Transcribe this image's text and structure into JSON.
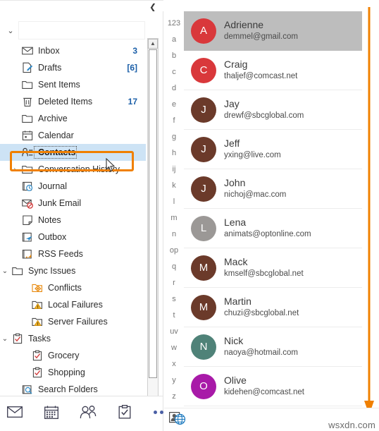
{
  "window": {
    "collapse_icon": "chevron-left-icon"
  },
  "sidebar": {
    "account_header": {
      "expander": "chevron-down-icon",
      "label": ""
    },
    "scrollbar": {
      "up_arrow": "▲",
      "down_arrow": "▼"
    },
    "items": [
      {
        "label": "Inbox",
        "count": "3",
        "icon": "envelope-icon",
        "indent": 1,
        "expander": "",
        "selected": false
      },
      {
        "label": "Drafts",
        "count": "[6]",
        "icon": "draft-pencil-icon",
        "indent": 1,
        "expander": "",
        "selected": false
      },
      {
        "label": "Sent Items",
        "count": "",
        "icon": "folder-icon",
        "indent": 1,
        "expander": "",
        "selected": false
      },
      {
        "label": "Deleted Items",
        "count": "17",
        "icon": "trash-icon",
        "indent": 1,
        "expander": "",
        "selected": false
      },
      {
        "label": "Archive",
        "count": "",
        "icon": "folder-icon",
        "indent": 1,
        "expander": "",
        "selected": false
      },
      {
        "label": "Calendar",
        "count": "",
        "icon": "calendar-icon",
        "indent": 1,
        "expander": "",
        "selected": false
      },
      {
        "label": "Contacts",
        "count": "",
        "icon": "contacts-icon",
        "indent": 1,
        "expander": "",
        "selected": true
      },
      {
        "label": "Conversation History",
        "count": "",
        "icon": "folder-icon",
        "indent": 1,
        "expander": "›",
        "selected": false
      },
      {
        "label": "Journal",
        "count": "",
        "icon": "journal-clock-icon",
        "indent": 1,
        "expander": "",
        "selected": false
      },
      {
        "label": "Junk Email",
        "count": "",
        "icon": "junk-email-icon",
        "indent": 1,
        "expander": "",
        "selected": false
      },
      {
        "label": "Notes",
        "count": "",
        "icon": "note-icon",
        "indent": 1,
        "expander": "",
        "selected": false
      },
      {
        "label": "Outbox",
        "count": "",
        "icon": "outbox-icon",
        "indent": 1,
        "expander": "",
        "selected": false
      },
      {
        "label": "RSS Feeds",
        "count": "",
        "icon": "rss-folder-icon",
        "indent": 1,
        "expander": "",
        "selected": false
      },
      {
        "label": "Sync Issues",
        "count": "",
        "icon": "folder-icon",
        "indent": 0,
        "expander": "⌄",
        "selected": false
      },
      {
        "label": "Conflicts",
        "count": "",
        "icon": "conflicts-icon",
        "indent": 2,
        "expander": "",
        "selected": false
      },
      {
        "label": "Local Failures",
        "count": "",
        "icon": "warning-folder-icon",
        "indent": 2,
        "expander": "",
        "selected": false
      },
      {
        "label": "Server Failures",
        "count": "",
        "icon": "warning-folder-icon",
        "indent": 2,
        "expander": "",
        "selected": false
      },
      {
        "label": "Tasks",
        "count": "",
        "icon": "task-clipboard-icon",
        "indent": 0,
        "expander": "⌄",
        "selected": false
      },
      {
        "label": "Grocery",
        "count": "",
        "icon": "task-clipboard-icon",
        "indent": 2,
        "expander": "",
        "selected": false
      },
      {
        "label": "Shopping",
        "count": "",
        "icon": "task-clipboard-icon",
        "indent": 2,
        "expander": "",
        "selected": false
      },
      {
        "label": "Search Folders",
        "count": "",
        "icon": "search-folder-icon",
        "indent": 1,
        "expander": "",
        "selected": false
      }
    ]
  },
  "alpha_index": [
    "123",
    "a",
    "b",
    "c",
    "d",
    "e",
    "f",
    "g",
    "h",
    "ij",
    "k",
    "l",
    "m",
    "n",
    "op",
    "q",
    "r",
    "s",
    "t",
    "uv",
    "w",
    "x",
    "y",
    "z"
  ],
  "people": [
    {
      "name": "Adrienne",
      "email": "demmel@gmail.com",
      "initial": "A",
      "color": "#d9383b",
      "selected": true
    },
    {
      "name": "Craig",
      "email": "thaljef@comcast.net",
      "initial": "C",
      "color": "#d9383b",
      "selected": false
    },
    {
      "name": "Jay",
      "email": "drewf@sbcglobal.com",
      "initial": "J",
      "color": "#6b3a2a",
      "selected": false
    },
    {
      "name": "Jeff",
      "email": "yxing@live.com",
      "initial": "J",
      "color": "#6b3a2a",
      "selected": false
    },
    {
      "name": "John",
      "email": "nichoj@mac.com",
      "initial": "J",
      "color": "#6b3a2a",
      "selected": false
    },
    {
      "name": "Lena",
      "email": "animats@optonline.com",
      "initial": "L",
      "color": "#9b9896",
      "selected": false
    },
    {
      "name": "Mack",
      "email": "kmself@sbcglobal.net",
      "initial": "M",
      "color": "#6b3a2a",
      "selected": false
    },
    {
      "name": "Martin",
      "email": "chuzi@sbcglobal.net",
      "initial": "M",
      "color": "#6b3a2a",
      "selected": false
    },
    {
      "name": "Nick",
      "email": "naoya@hotmail.com",
      "initial": "N",
      "color": "#4f8278",
      "selected": false
    },
    {
      "name": "Olive",
      "email": "kidehen@comcast.net",
      "initial": "O",
      "color": "#a81aa8",
      "selected": false
    }
  ],
  "bottom_nav": [
    {
      "icon": "mail-icon",
      "name": "Mail"
    },
    {
      "icon": "calendar-icon",
      "name": "Calendar"
    },
    {
      "icon": "people-icon",
      "name": "People"
    },
    {
      "icon": "tasks-icon",
      "name": "Tasks"
    },
    {
      "icon": "more-icon",
      "name": "More"
    }
  ],
  "status": {
    "connected_icon": "people-globe-icon",
    "watermark": "wsxdn.com"
  },
  "annotation": {
    "highlight_color": "#f08000",
    "arrow_icon": "down-arrow-annotation"
  }
}
